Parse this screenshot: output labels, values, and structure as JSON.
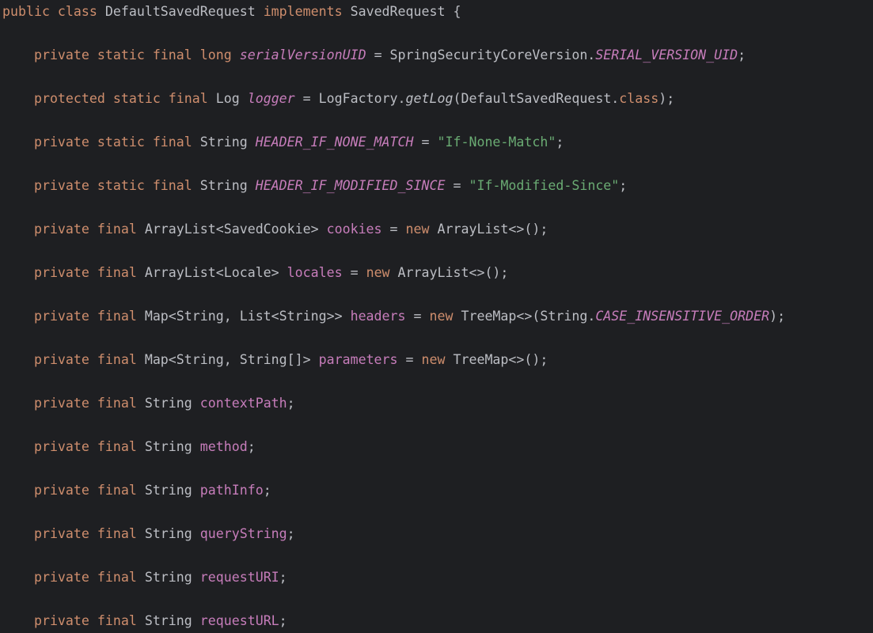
{
  "editor": {
    "language": "Java",
    "colors": {
      "background": "#1e1f22",
      "plain": "#bcbec4",
      "keyword": "#cf8e6d",
      "field": "#c77dbb",
      "string": "#6aab73"
    },
    "lines": [
      {
        "name": "class-declaration",
        "tokens": [
          {
            "t": "keyword",
            "v": "public class "
          },
          {
            "t": "plain",
            "v": "DefaultSavedRequest "
          },
          {
            "t": "keyword",
            "v": "implements "
          },
          {
            "t": "plain",
            "v": "SavedRequest {"
          }
        ]
      },
      {
        "name": "field-serialVersionUID",
        "tokens": [
          {
            "t": "keyword",
            "v": "    private static final long "
          },
          {
            "t": "static-field",
            "v": "serialVersionUID"
          },
          {
            "t": "plain",
            "v": " = SpringSecurityCoreVersion."
          },
          {
            "t": "static-field",
            "v": "SERIAL_VERSION_UID"
          },
          {
            "t": "plain",
            "v": ";"
          }
        ]
      },
      {
        "name": "field-logger",
        "tokens": [
          {
            "t": "keyword",
            "v": "    protected static final "
          },
          {
            "t": "plain",
            "v": "Log "
          },
          {
            "t": "static-field",
            "v": "logger"
          },
          {
            "t": "plain",
            "v": " = LogFactory."
          },
          {
            "t": "static-method",
            "v": "getLog"
          },
          {
            "t": "plain",
            "v": "(DefaultSavedRequest."
          },
          {
            "t": "keyword",
            "v": "class"
          },
          {
            "t": "plain",
            "v": ");"
          }
        ]
      },
      {
        "name": "field-header-if-none-match",
        "tokens": [
          {
            "t": "keyword",
            "v": "    private static final "
          },
          {
            "t": "plain",
            "v": "String "
          },
          {
            "t": "static-field",
            "v": "HEADER_IF_NONE_MATCH"
          },
          {
            "t": "plain",
            "v": " = "
          },
          {
            "t": "string",
            "v": "\"If-None-Match\""
          },
          {
            "t": "plain",
            "v": ";"
          }
        ]
      },
      {
        "name": "field-header-if-modified-since",
        "tokens": [
          {
            "t": "keyword",
            "v": "    private static final "
          },
          {
            "t": "plain",
            "v": "String "
          },
          {
            "t": "static-field",
            "v": "HEADER_IF_MODIFIED_SINCE"
          },
          {
            "t": "plain",
            "v": " = "
          },
          {
            "t": "string",
            "v": "\"If-Modified-Since\""
          },
          {
            "t": "plain",
            "v": ";"
          }
        ]
      },
      {
        "name": "field-cookies",
        "tokens": [
          {
            "t": "keyword",
            "v": "    private final "
          },
          {
            "t": "plain",
            "v": "ArrayList<SavedCookie> "
          },
          {
            "t": "field",
            "v": "cookies"
          },
          {
            "t": "plain",
            "v": " = "
          },
          {
            "t": "keyword",
            "v": "new "
          },
          {
            "t": "plain",
            "v": "ArrayList<>();"
          }
        ]
      },
      {
        "name": "field-locales",
        "tokens": [
          {
            "t": "keyword",
            "v": "    private final "
          },
          {
            "t": "plain",
            "v": "ArrayList<Locale> "
          },
          {
            "t": "field",
            "v": "locales"
          },
          {
            "t": "plain",
            "v": " = "
          },
          {
            "t": "keyword",
            "v": "new "
          },
          {
            "t": "plain",
            "v": "ArrayList<>();"
          }
        ]
      },
      {
        "name": "field-headers",
        "tokens": [
          {
            "t": "keyword",
            "v": "    private final "
          },
          {
            "t": "plain",
            "v": "Map<String, List<String>> "
          },
          {
            "t": "field",
            "v": "headers"
          },
          {
            "t": "plain",
            "v": " = "
          },
          {
            "t": "keyword",
            "v": "new "
          },
          {
            "t": "plain",
            "v": "TreeMap<>(String."
          },
          {
            "t": "static-field",
            "v": "CASE_INSENSITIVE_ORDER"
          },
          {
            "t": "plain",
            "v": ");"
          }
        ]
      },
      {
        "name": "field-parameters",
        "tokens": [
          {
            "t": "keyword",
            "v": "    private final "
          },
          {
            "t": "plain",
            "v": "Map<String, String[]> "
          },
          {
            "t": "field",
            "v": "parameters"
          },
          {
            "t": "plain",
            "v": " = "
          },
          {
            "t": "keyword",
            "v": "new "
          },
          {
            "t": "plain",
            "v": "TreeMap<>();"
          }
        ]
      },
      {
        "name": "field-contextPath",
        "tokens": [
          {
            "t": "keyword",
            "v": "    private final "
          },
          {
            "t": "plain",
            "v": "String "
          },
          {
            "t": "field",
            "v": "contextPath"
          },
          {
            "t": "plain",
            "v": ";"
          }
        ]
      },
      {
        "name": "field-method",
        "tokens": [
          {
            "t": "keyword",
            "v": "    private final "
          },
          {
            "t": "plain",
            "v": "String "
          },
          {
            "t": "field",
            "v": "method"
          },
          {
            "t": "plain",
            "v": ";"
          }
        ]
      },
      {
        "name": "field-pathInfo",
        "tokens": [
          {
            "t": "keyword",
            "v": "    private final "
          },
          {
            "t": "plain",
            "v": "String "
          },
          {
            "t": "field",
            "v": "pathInfo"
          },
          {
            "t": "plain",
            "v": ";"
          }
        ]
      },
      {
        "name": "field-queryString",
        "tokens": [
          {
            "t": "keyword",
            "v": "    private final "
          },
          {
            "t": "plain",
            "v": "String "
          },
          {
            "t": "field",
            "v": "queryString"
          },
          {
            "t": "plain",
            "v": ";"
          }
        ]
      },
      {
        "name": "field-requestURI",
        "tokens": [
          {
            "t": "keyword",
            "v": "    private final "
          },
          {
            "t": "plain",
            "v": "String "
          },
          {
            "t": "field",
            "v": "requestURI"
          },
          {
            "t": "plain",
            "v": ";"
          }
        ]
      },
      {
        "name": "field-requestURL",
        "tokens": [
          {
            "t": "keyword",
            "v": "    private final "
          },
          {
            "t": "plain",
            "v": "String "
          },
          {
            "t": "field",
            "v": "requestURL"
          },
          {
            "t": "plain",
            "v": ";"
          }
        ]
      }
    ]
  }
}
